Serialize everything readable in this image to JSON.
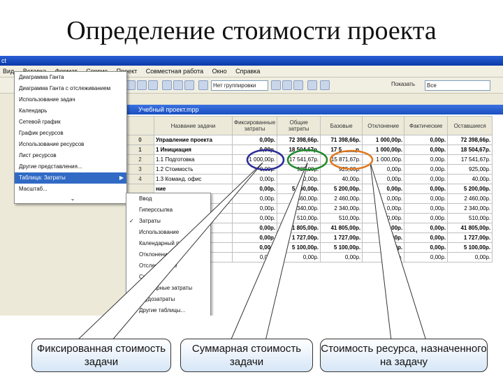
{
  "slide_title": "Определение стоимости проекта",
  "window_title": "ct",
  "menubar": [
    "Вид",
    "Вставка",
    "Формат",
    "Сервис",
    "Проект",
    "Совместная работа",
    "Окно",
    "Справка"
  ],
  "toolbar": {
    "group_combo": "Нет группировки",
    "show_label": "Показать",
    "font_combo": "Все"
  },
  "document_title": "Учебный проект.mpp",
  "table": {
    "headers": [
      "",
      "Название задачи",
      "Фиксированные затраты",
      "Общие затраты",
      "Базовые",
      "Отклонение",
      "Фактические",
      "Оставшиеся"
    ],
    "rows": [
      {
        "id": "0",
        "name": "Управление проекта",
        "fixed": "0,00р.",
        "total": "72 398,66р.",
        "base": "71 398,66р.",
        "dev": "1 000,00р.",
        "fact": "0,00р.",
        "rest": "72 398,66р.",
        "bold": true
      },
      {
        "id": "1",
        "name": "1 Инициация",
        "fixed": "0,00р.",
        "total": "18 504,67р.",
        "base": "17 5__,__р.",
        "dev": "1 000,00р.",
        "fact": "0,00р.",
        "rest": "18 504,67р.",
        "bold": true
      },
      {
        "id": "2",
        "name": "1.1 Подготовка",
        "fixed": "1 000,00р.",
        "total": "17 541,67р.",
        "base": "15 871,67р.",
        "dev": "1 000,00р.",
        "fact": "0,00р.",
        "rest": "17 541,67р.",
        "bold": false
      },
      {
        "id": "3",
        "name": "1.2 Стоимость",
        "fixed": "0,00р.",
        "total": "925,00р.",
        "base": "925,00р.",
        "dev": "0,00р.",
        "fact": "0,00р.",
        "rest": "925,00р.",
        "bold": false
      },
      {
        "id": "4",
        "name": "1.3 Команд. офис",
        "fixed": "0,00р.",
        "total": "40,00р.",
        "base": "40,00р.",
        "dev": "0,00р.",
        "fact": "0,00р.",
        "rest": "40,00р.",
        "bold": false
      },
      {
        "id": "",
        "name": "ние",
        "fixed": "0,00р.",
        "total": "5 200,00р.",
        "base": "5 200,00р.",
        "dev": "0,00р.",
        "fact": "0,00р.",
        "rest": "5 200,00р.",
        "bold": true
      },
      {
        "id": "",
        "name": "",
        "fixed": "0,00р.",
        "total": "2 460,00р.",
        "base": "2 460,00р.",
        "dev": "0,00р.",
        "fact": "0,00р.",
        "rest": "2 460,00р.",
        "bold": false
      },
      {
        "id": "",
        "name": "",
        "fixed": "0,00р.",
        "total": "2 340,00р.",
        "base": "2 340,00р.",
        "dev": "0,00р.",
        "fact": "0,00р.",
        "rest": "2 340,00р.",
        "bold": false
      },
      {
        "id": "",
        "name": "",
        "fixed": "0,00р.",
        "total": "510,00р.",
        "base": "510,00р.",
        "dev": "0,00р.",
        "fact": "0,00р.",
        "rest": "510,00р.",
        "bold": false
      },
      {
        "id": "",
        "name": "",
        "fixed": "0,00р.",
        "total": "41 805,00р.",
        "base": "41 805,00р.",
        "dev": "0,00р.",
        "fact": "0,00р.",
        "rest": "41 805,00р.",
        "bold": true
      },
      {
        "id": "",
        "name": "",
        "fixed": "0,00р.",
        "total": "1 727,00р.",
        "base": "1 727,00р.",
        "dev": "0,00р.",
        "fact": "0,00р.",
        "rest": "1 727,00р.",
        "bold": true
      },
      {
        "id": "",
        "name": "",
        "fixed": "0,00р.",
        "total": "5 100,00р.",
        "base": "5 100,00р.",
        "dev": "0,00р.",
        "fact": "0,00р.",
        "rest": "5 100,00р.",
        "bold": true
      },
      {
        "id": "",
        "name": "",
        "fixed": "0,00р.",
        "total": "0,00р.",
        "base": "0,00р.",
        "dev": "0,00р.",
        "fact": "0,00р.",
        "rest": "0,00р.",
        "bold": false
      }
    ]
  },
  "view_menu": [
    "Диаграмма Ганта",
    "Диаграмма Ганта с отслеживанием",
    "Использование задач",
    "Календарь",
    "Сетевой график",
    "График ресурсов",
    "Использование ресурсов",
    "Лист ресурсов",
    "Другие представления...",
    "Таблица: Затраты",
    "Масштаб..."
  ],
  "table_submenu": [
    "Ввод",
    "Гиперссылка",
    "Затраты",
    "Использование",
    "Календарный план",
    "Отклонение",
    "Отслеживание",
    "Сводная",
    "Суммарные затраты",
    "Трудозатраты",
    "Другие таблицы..."
  ],
  "callouts": {
    "fixed": "Фиксированная стоимость задачи",
    "total": "Суммарная стоимость задачи",
    "resource": "Стоимость ресурса, назначенного на задачу"
  },
  "colors": {
    "circle_fixed": "#2c2c9a",
    "circle_total": "#1e8a2a",
    "circle_resource": "#e07820"
  }
}
